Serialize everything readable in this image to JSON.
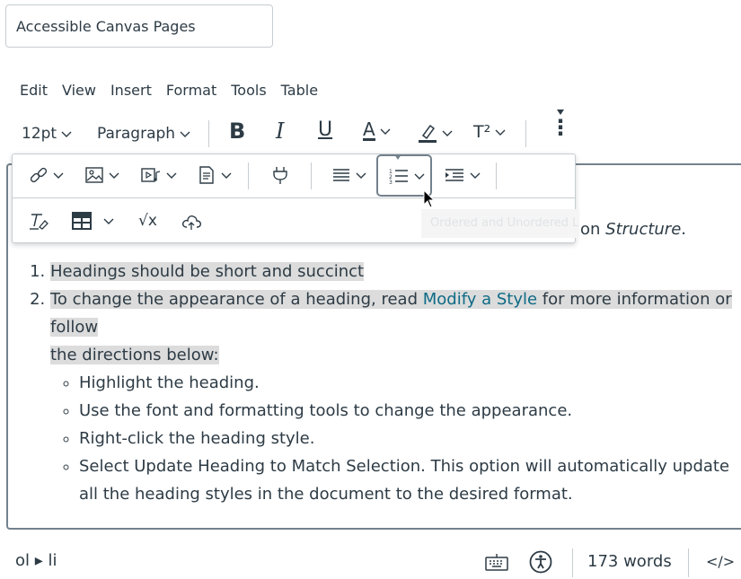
{
  "title_input": {
    "value": "Accessible Canvas Pages"
  },
  "menubar": {
    "items": [
      "Edit",
      "View",
      "Insert",
      "Format",
      "Tools",
      "Table"
    ]
  },
  "toolbar": {
    "font_size": "12pt",
    "block_format": "Paragraph",
    "bold_label": "B",
    "italic_label": "I",
    "underline_label": "U",
    "text_color_label": "A",
    "superscript_label": "T²",
    "more_label": "⋮"
  },
  "popup_toolbar": {
    "tooltip": "Ordered and Unordered Lists",
    "sqrt_label": "√x"
  },
  "content": {
    "partial_line_prefix": "on ",
    "partial_line_italic": "Structure",
    "partial_line_suffix": ".",
    "ordered_items": [
      {
        "text": "Headings should be short and succinct"
      },
      {
        "text_before": "To change the appearance of a heading, read ",
        "link": "Modify a Style",
        "text_after": " for more information or follow",
        "text_line2": "the directions below:",
        "bullets": [
          "Highlight the heading.",
          "Use the font and formatting tools to change the appearance.",
          "Right-click the heading style.",
          "Select Update Heading to Match Selection. This option will automatically update all the heading styles in the document to the desired format."
        ]
      }
    ]
  },
  "statusbar": {
    "path": "ol ▸ li",
    "word_count": "173 words",
    "html_toggle": "</>"
  },
  "colors": {
    "link": "#0e6b86",
    "text": "#2d3b45",
    "highlight": "#dcdcdc",
    "border": "#73818c"
  }
}
